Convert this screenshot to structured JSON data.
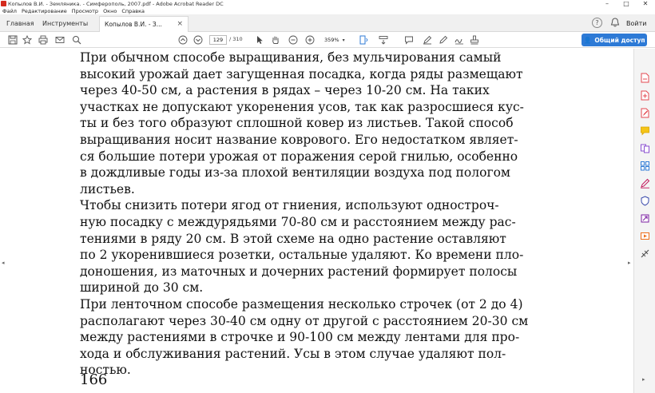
{
  "window": {
    "title": "Копылов В.И. - Земляника. - Симферополь, 2007.pdf - Adobe Acrobat Reader DC",
    "controls": [
      "–",
      "□",
      "✕"
    ]
  },
  "menu": [
    "Файл",
    "Редактирование",
    "Просмотр",
    "Окно",
    "Справка"
  ],
  "tabs": {
    "home": "Главная",
    "tools": "Инструменты",
    "document": "Копылов В.И. - З...",
    "close": "×"
  },
  "account": {
    "help": "?",
    "sign_in": "Войти"
  },
  "toolbar": {
    "page_current": "129",
    "page_total": "/ 310",
    "zoom": "359%",
    "share_label": "Общий доступ"
  },
  "document": {
    "lines": [
      "При обычном  способе выращивания, без мульчирования самый",
      "высокий урожай дает загущенная посадка, когда ряды размещают",
      "через 40-50 см,  а растения в  рядах  –  через 10-20 см. На таких",
      "участках не допускают укоренения усов, так как разросшиеся кус-",
      "ты  и без того образуют сплошной ковер из листьев. Такой способ",
      "выращивания носит название коврового. Его недостатком являет-",
      "ся большие потери урожая от поражения серой гнилью, особенно",
      "в  дождливые годы  из-за плохой вентиляции воздуха под пологом",
      "листьев.",
      "     Чтобы снизить потери ягод от гниения, используют одностроч-",
      "ную посадку с междурядьями 70-80 см  и расстоянием  между рас-",
      "тениями в  ряду 20 см. В этой схеме на одно растение оставляют",
      "по 2 укоренившиеся розетки, остальные удаляют. Ко времени пло-",
      "доношения, из маточных и дочерних растений формирует полосы",
      "шириной до  30 см.",
      "     При ленточном  способе размещения несколько строчек (от 2 до 4)",
      "располагают через 30-40 см  одну от другой с расстоянием  20-30 см",
      "между растениями в  строчке и 90-100 см  между лентами для про-",
      "хода и обслуживания растений. Усы в  этом  случае удаляют пол-",
      "ностью."
    ],
    "page_number": "166"
  },
  "colors": {
    "accent": "#2d7ad6",
    "acrobat_red": "#d52b1e"
  }
}
